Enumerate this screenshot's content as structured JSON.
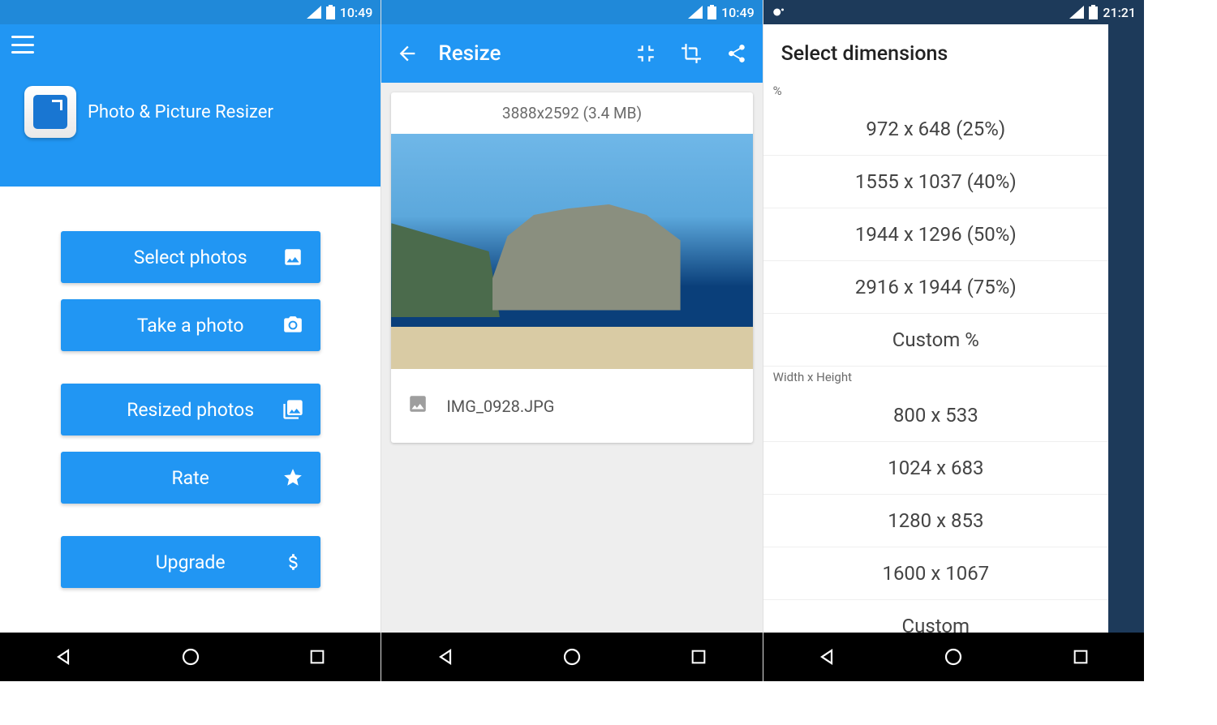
{
  "screen1": {
    "status": {
      "time": "10:49"
    },
    "brand": "Photo & Picture Resizer",
    "buttons": {
      "select": "Select photos",
      "take": "Take a photo",
      "resized": "Resized photos",
      "rate": "Rate",
      "upgrade": "Upgrade"
    }
  },
  "screen2": {
    "status": {
      "time": "10:49"
    },
    "title": "Resize",
    "photo": {
      "dimensions": "3888x2592 (3.4 MB)",
      "filename": "IMG_0928.JPG"
    }
  },
  "screen3": {
    "status": {
      "time": "21:21"
    },
    "title": "Select dimensions",
    "group_percent_label": "%",
    "group_wh_label": "Width x Height",
    "percent_options": [
      "972 x 648  (25%)",
      "1555 x 1037  (40%)",
      "1944 x 1296  (50%)",
      "2916 x 1944  (75%)",
      "Custom %"
    ],
    "wh_options": [
      "800 x 533",
      "1024 x 683",
      "1280 x 853",
      "1600 x 1067",
      "Custom"
    ]
  }
}
